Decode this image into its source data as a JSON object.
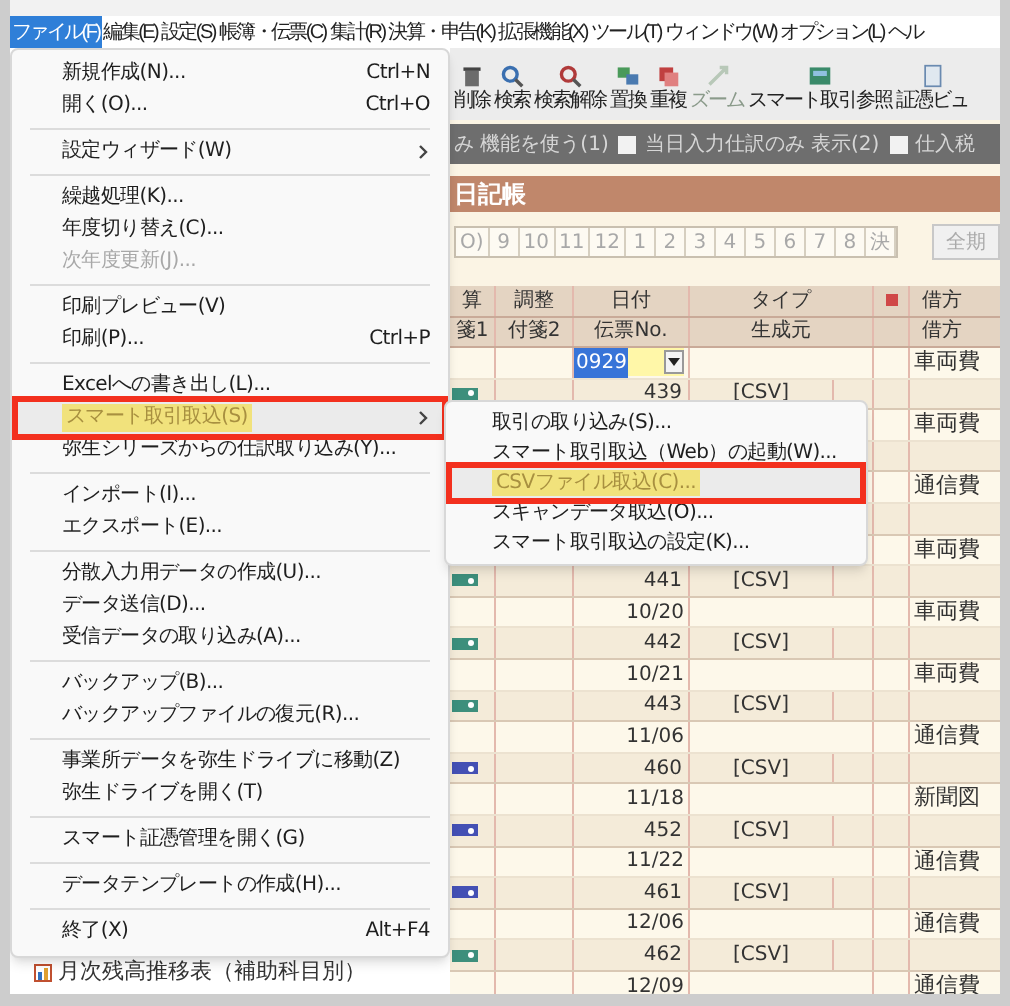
{
  "menu_bar": [
    {
      "label": "ファイル(F)",
      "selected": true
    },
    {
      "label": "編集(E)",
      "selected": false
    },
    {
      "label": "設定(S)",
      "selected": false
    },
    {
      "label": "帳簿・伝票(C)",
      "selected": false
    },
    {
      "label": "集計(R)",
      "selected": false
    },
    {
      "label": "決算・申告(K)",
      "selected": false
    },
    {
      "label": "拡張機能(X)",
      "selected": false
    },
    {
      "label": "ツール(T)",
      "selected": false
    },
    {
      "label": "ウィンドウ(W)",
      "selected": false
    },
    {
      "label": "オプション(L)",
      "selected": false
    },
    {
      "label": "ヘル",
      "selected": false
    }
  ],
  "toolbar": [
    {
      "label": "削除",
      "disabled": false
    },
    {
      "label": "検索",
      "disabled": false
    },
    {
      "label": "検索解除",
      "disabled": false
    },
    {
      "label": "置換",
      "disabled": false
    },
    {
      "label": "重複",
      "disabled": false
    },
    {
      "label": "ズーム",
      "disabled": true
    },
    {
      "label": "スマート取引参照",
      "disabled": false
    },
    {
      "label": "証憑ビュ",
      "disabled": false
    }
  ],
  "options_bar": [
    {
      "label": "み 機能を使う(1)",
      "kind": "label"
    },
    {
      "label": "当日入力仕訳のみ 表示(2)",
      "kind": "checkbox",
      "checked": false
    },
    {
      "label": "仕入税",
      "kind": "checkbox",
      "checked": false
    }
  ],
  "journal_title": "日記帳",
  "month_tabs": [
    "O)",
    "9",
    "10",
    "11",
    "12",
    "1",
    "2",
    "3",
    "4",
    "5",
    "6",
    "7",
    "8",
    "決"
  ],
  "all_period_button": "全期",
  "table": {
    "header_top": [
      "算",
      "調整",
      "日付",
      "タイプ",
      "借方"
    ],
    "header_bottom": [
      "箋1",
      "付箋2",
      "伝票No.",
      "生成元",
      "借方"
    ],
    "entries": [
      {
        "date": "0929",
        "editing": true,
        "number": "439",
        "source": "[CSV]",
        "account": "車両費",
        "color": "#3d8f7c"
      },
      {
        "editing": false,
        "account": "車両費"
      },
      {
        "editing": false,
        "account": "通信費"
      },
      {
        "editing": false,
        "account": "車両費",
        "number": "441",
        "source": "[CSV]",
        "color": "#3d8f7c"
      },
      {
        "date": "10/20",
        "editing": false,
        "number": "442",
        "source": "[CSV]",
        "account": "車両費",
        "color": "#3d8f7c"
      },
      {
        "date": "10/21",
        "editing": false,
        "number": "443",
        "source": "[CSV]",
        "account": "車両費",
        "color": "#3d8f7c"
      },
      {
        "date": "11/06",
        "editing": false,
        "number": "460",
        "source": "[CSV]",
        "account": "通信費",
        "color": "#4450b4"
      },
      {
        "date": "11/18",
        "editing": false,
        "number": "452",
        "source": "[CSV]",
        "account": "新聞図",
        "color": "#4450b4"
      },
      {
        "date": "11/22",
        "editing": false,
        "number": "461",
        "source": "[CSV]",
        "account": "通信費",
        "color": "#4450b4"
      },
      {
        "date": "12/06",
        "editing": false,
        "number": "462",
        "source": "[CSV]",
        "account": "通信費",
        "color": "#3d8f7c"
      },
      {
        "date": "12/09",
        "editing": false,
        "account": "通信費"
      }
    ]
  },
  "sidebar": {
    "items": [
      "月次残高推移表（補助科目別）"
    ]
  },
  "file_menu": [
    {
      "kind": "item",
      "label": "新規作成(N)...",
      "shortcut": "Ctrl+N",
      "disabled": false,
      "selected": false,
      "submenu": false
    },
    {
      "kind": "item",
      "label": "開く(O)...",
      "shortcut": "Ctrl+O",
      "disabled": false,
      "selected": false,
      "submenu": false
    },
    {
      "kind": "separator"
    },
    {
      "kind": "item",
      "label": "設定ウィザード(W)",
      "disabled": false,
      "selected": false,
      "submenu": true
    },
    {
      "kind": "separator"
    },
    {
      "kind": "item",
      "label": "繰越処理(K)...",
      "disabled": false,
      "selected": false,
      "submenu": false
    },
    {
      "kind": "item",
      "label": "年度切り替え(C)...",
      "disabled": false,
      "selected": false,
      "submenu": false
    },
    {
      "kind": "item",
      "label": "次年度更新(J)...",
      "disabled": true,
      "selected": false,
      "submenu": false
    },
    {
      "kind": "separator"
    },
    {
      "kind": "item",
      "label": "印刷プレビュー(V)",
      "disabled": false,
      "selected": false,
      "submenu": false
    },
    {
      "kind": "item",
      "label": "印刷(P)...",
      "shortcut": "Ctrl+P",
      "disabled": false,
      "selected": false,
      "submenu": false
    },
    {
      "kind": "separator"
    },
    {
      "kind": "item",
      "label": "Excelへの書き出し(L)...",
      "disabled": false,
      "selected": false,
      "submenu": false
    },
    {
      "kind": "item",
      "label": "スマート取引取込(S)",
      "disabled": false,
      "selected": true,
      "submenu": true
    },
    {
      "kind": "item",
      "label": "弥生シリーズからの仕訳取り込み(Y)...",
      "disabled": false,
      "selected": false,
      "submenu": false
    },
    {
      "kind": "separator"
    },
    {
      "kind": "item",
      "label": "インポート(I)...",
      "disabled": false,
      "selected": false,
      "submenu": false
    },
    {
      "kind": "item",
      "label": "エクスポート(E)...",
      "disabled": false,
      "selected": false,
      "submenu": false
    },
    {
      "kind": "separator"
    },
    {
      "kind": "item",
      "label": "分散入力用データの作成(U)...",
      "disabled": false,
      "selected": false,
      "submenu": false
    },
    {
      "kind": "item",
      "label": "データ送信(D)...",
      "disabled": false,
      "selected": false,
      "submenu": false
    },
    {
      "kind": "item",
      "label": "受信データの取り込み(A)...",
      "disabled": false,
      "selected": false,
      "submenu": false
    },
    {
      "kind": "separator"
    },
    {
      "kind": "item",
      "label": "バックアップ(B)...",
      "disabled": false,
      "selected": false,
      "submenu": false
    },
    {
      "kind": "item",
      "label": "バックアップファイルの復元(R)...",
      "disabled": false,
      "selected": false,
      "submenu": false
    },
    {
      "kind": "separator"
    },
    {
      "kind": "item",
      "label": "事業所データを弥生ドライブに移動(Z)",
      "disabled": false,
      "selected": false,
      "submenu": false
    },
    {
      "kind": "item",
      "label": "弥生ドライブを開く(T)",
      "disabled": false,
      "selected": false,
      "submenu": false
    },
    {
      "kind": "separator"
    },
    {
      "kind": "item",
      "label": "スマート証憑管理を開く(G)",
      "disabled": false,
      "selected": false,
      "submenu": false
    },
    {
      "kind": "separator"
    },
    {
      "kind": "item",
      "label": "データテンプレートの作成(H)...",
      "disabled": false,
      "selected": false,
      "submenu": false
    },
    {
      "kind": "separator"
    },
    {
      "kind": "item",
      "label": "終了(X)",
      "shortcut": "Alt+F4",
      "disabled": false,
      "selected": false,
      "submenu": false
    }
  ],
  "submenu": [
    {
      "label": "取引の取り込み(S)...",
      "selected": false
    },
    {
      "label": "スマート取引取込（Web）の起動(W)...",
      "selected": false
    },
    {
      "label": "CSVファイル取込(C)...",
      "selected": true
    },
    {
      "label": "スキャンデータ取込(O)...",
      "selected": false
    },
    {
      "label": "スマート取引取込の設定(K)...",
      "selected": false
    }
  ]
}
